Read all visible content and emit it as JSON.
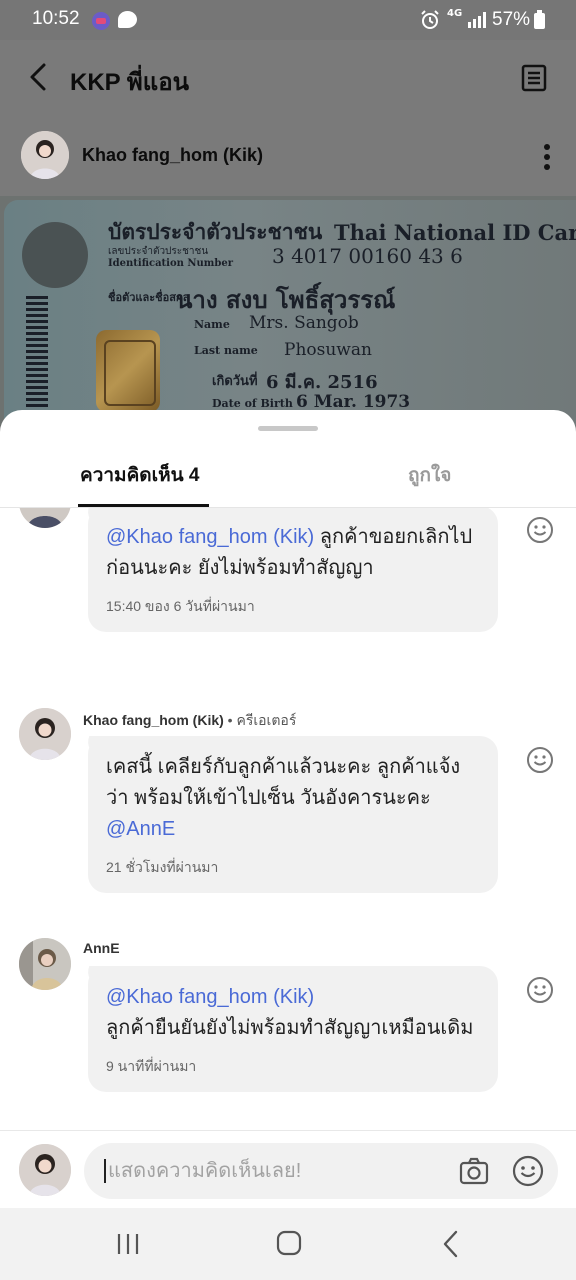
{
  "status_bar": {
    "time": "10:52",
    "network": "4G",
    "battery": "57%"
  },
  "header": {
    "title": "KKP พี่แอน"
  },
  "post": {
    "author": "Khao fang_hom (Kik)"
  },
  "id_card": {
    "title_th": "บัตรประจำตัวประชาชน",
    "title_en": "Thai National ID Card",
    "id_label_th": "เลขประจำตัวประชาชน",
    "id_label_en": "Identification Number",
    "id_number": "3 4017 00160 43 6",
    "name_label_th": "ชื่อตัวและชื่อสกุล",
    "name_th": "นาง สงบ โพธิ์สุวรรณ์",
    "name_label_en": "Name",
    "name_en": "Mrs. Sangob",
    "last_name_label": "Last name",
    "last_name": "Phosuwan",
    "dob_label_th": "เกิดวันที่",
    "dob_th": "6 มี.ค. 2516",
    "dob_label_en": "Date of Birth",
    "dob_en": "6 Mar. 1973"
  },
  "sheet": {
    "tabs": [
      {
        "label": "ความคิดเห็น 4",
        "active": true
      },
      {
        "label": "ถูกใจ",
        "active": false
      }
    ],
    "comments": [
      {
        "mention": "@Khao fang_hom (Kik)",
        "text": " ลูกค้าขอยกเลิกไปก่อนนะคะ ยังไม่พร้อมทำสัญญา",
        "time": "15:40 ของ 6 วันที่ผ่านมา"
      },
      {
        "author": "Khao fang_hom (Kik)",
        "role": "• ครีเอเตอร์",
        "text": "เคสนี้ เคลียร์กับลูกค้าแล้วนะคะ ลูกค้าแจ้งว่า พร้อมให้เข้าไปเซ็น วันอังคารนะคะ ",
        "mention": "@AnnE",
        "time": "21 ชั่วโมงที่ผ่านมา"
      },
      {
        "author": "AnnE",
        "mention": "@Khao fang_hom (Kik)",
        "text": "ลูกค้ายืนยันยังไม่พร้อมทำสัญญาเหมือนเดิม",
        "time": "9 นาทีที่ผ่านมา"
      }
    ]
  },
  "input": {
    "placeholder": "แสดงความคิดเห็นเลย!"
  },
  "colors": {
    "mention": "#4a6ad6",
    "bubble": "#f1f1f1",
    "overlay": "#7a7a7a"
  }
}
